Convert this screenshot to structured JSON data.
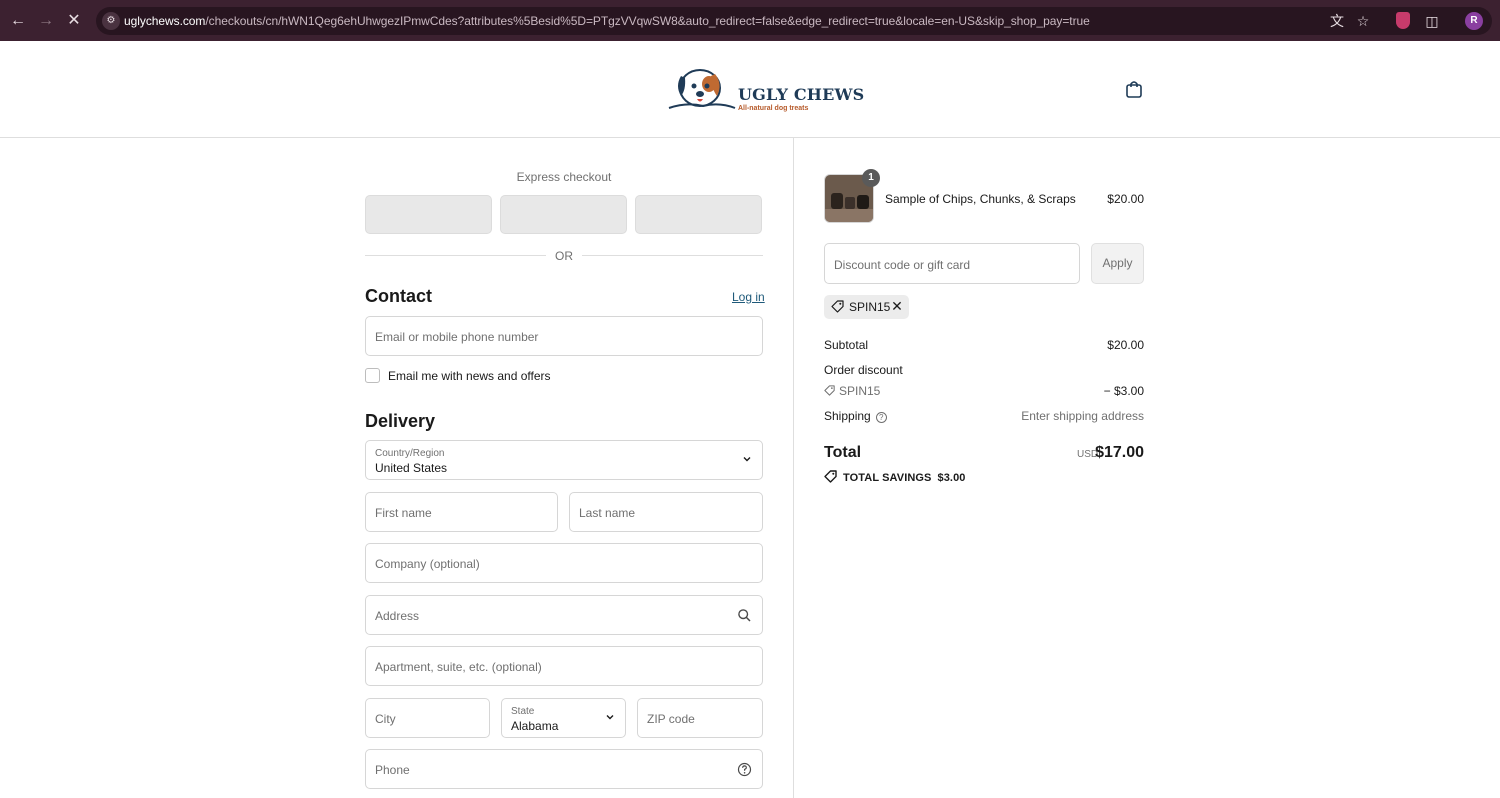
{
  "browser": {
    "url_host": "uglychews.com",
    "url_rest": "/checkouts/cn/hWN1Qeg6ehUhwgezIPmwCdes?attributes%5Besid%5D=PTgzVVqwSW8&auto_redirect=false&edge_redirect=true&locale=en-US&skip_shop_pay=true",
    "profile_initial": "R",
    "colors": {
      "frame": "#3c2130",
      "address_bar": "#281520"
    }
  },
  "store": {
    "logo_title": "UGLY CHEWS",
    "logo_subtitle": "All-natural dog treats",
    "cart_icon": "shopping-bag-icon"
  },
  "checkout": {
    "express_label": "Express checkout",
    "or_label": "OR",
    "contact": {
      "title": "Contact",
      "login_link": "Log in",
      "email_placeholder": "Email or mobile phone number",
      "newsletter_label": "Email me with news and offers",
      "newsletter_checked": false
    },
    "delivery": {
      "title": "Delivery",
      "country_label": "Country/Region",
      "country_value": "United States",
      "first_name_placeholder": "First name",
      "last_name_placeholder": "Last name",
      "company_placeholder": "Company (optional)",
      "address_placeholder": "Address",
      "apartment_placeholder": "Apartment, suite, etc. (optional)",
      "city_placeholder": "City",
      "state_label": "State",
      "state_value": "Alabama",
      "zip_placeholder": "ZIP code",
      "phone_placeholder": "Phone"
    }
  },
  "summary": {
    "item": {
      "quantity": "1",
      "name": "Sample of Chips, Chunks, & Scraps",
      "price": "$20.00"
    },
    "discount_placeholder": "Discount code or gift card",
    "apply_label": "Apply",
    "applied_code": "SPIN15",
    "subtotal_label": "Subtotal",
    "subtotal_value": "$20.00",
    "order_discount_label": "Order discount",
    "discount_code": "SPIN15",
    "discount_value": "− $3.00",
    "shipping_label": "Shipping",
    "shipping_value": "Enter shipping address",
    "total_label": "Total",
    "total_currency": "USD",
    "total_value": "$17.00",
    "savings_label": "TOTAL SAVINGS",
    "savings_value": "$3.00"
  }
}
